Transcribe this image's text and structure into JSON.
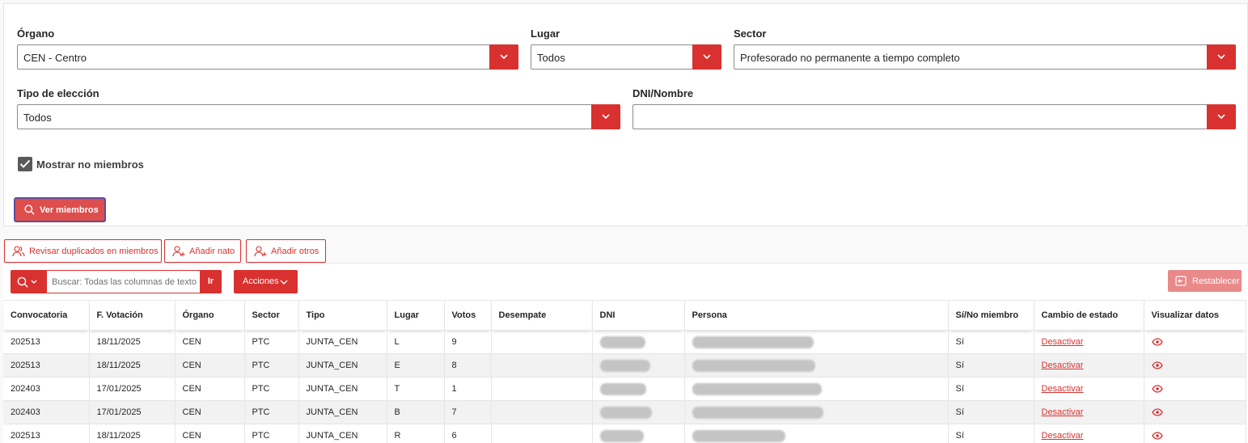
{
  "filters": {
    "organo": {
      "label": "Órgano",
      "value": "CEN - Centro"
    },
    "lugar": {
      "label": "Lugar",
      "value": "Todos"
    },
    "sector": {
      "label": "Sector",
      "value": "Profesorado no permanente a tiempo completo"
    },
    "tipo": {
      "label": "Tipo de elección",
      "value": "Todos"
    },
    "dni": {
      "label": "DNI/Nombre",
      "value": ""
    },
    "mostrar_no_miembros": {
      "label": "Mostrar no miembros",
      "checked": true
    },
    "ver_miembros": "Ver miembros"
  },
  "actions": {
    "revisar": "Revisar duplicados en miembros",
    "anadir_nato": "Añadir nato",
    "anadir_otros": "Añadir otros"
  },
  "toolbar": {
    "search_placeholder": "Buscar: Todas las columnas de texto",
    "go": "Ir",
    "acciones": "Acciones",
    "restablecer": "Restablecer"
  },
  "colors": {
    "accent": "#d9312f"
  },
  "table": {
    "columns": [
      "Convocatoria",
      "F. Votación",
      "Órgano",
      "Sector",
      "Tipo",
      "Lugar",
      "Votos",
      "Desempate",
      "DNI",
      "Persona",
      "Sí/No miembro",
      "Cambio de estado",
      "Visualizar datos"
    ],
    "rows": [
      {
        "convocatoria": "202513",
        "fecha": "18/11/2025",
        "organo": "CEN",
        "sector": "PTC",
        "tipo": "JUNTA_CEN",
        "lugar": "L",
        "votos": "9",
        "desempate": "",
        "miembro": "Sí",
        "estado": "Desactivar"
      },
      {
        "convocatoria": "202513",
        "fecha": "18/11/2025",
        "organo": "CEN",
        "sector": "PTC",
        "tipo": "JUNTA_CEN",
        "lugar": "E",
        "votos": "8",
        "desempate": "",
        "miembro": "Sí",
        "estado": "Desactivar"
      },
      {
        "convocatoria": "202403",
        "fecha": "17/01/2025",
        "organo": "CEN",
        "sector": "PTC",
        "tipo": "JUNTA_CEN",
        "lugar": "T",
        "votos": "1",
        "desempate": "",
        "miembro": "Sí",
        "estado": "Desactivar"
      },
      {
        "convocatoria": "202403",
        "fecha": "17/01/2025",
        "organo": "CEN",
        "sector": "PTC",
        "tipo": "JUNTA_CEN",
        "lugar": "B",
        "votos": "7",
        "desempate": "",
        "miembro": "Sí",
        "estado": "Desactivar"
      },
      {
        "convocatoria": "202513",
        "fecha": "18/11/2025",
        "organo": "CEN",
        "sector": "PTC",
        "tipo": "JUNTA_CEN",
        "lugar": "R",
        "votos": "6",
        "desempate": "",
        "miembro": "Sí",
        "estado": "Desactivar"
      }
    ]
  }
}
